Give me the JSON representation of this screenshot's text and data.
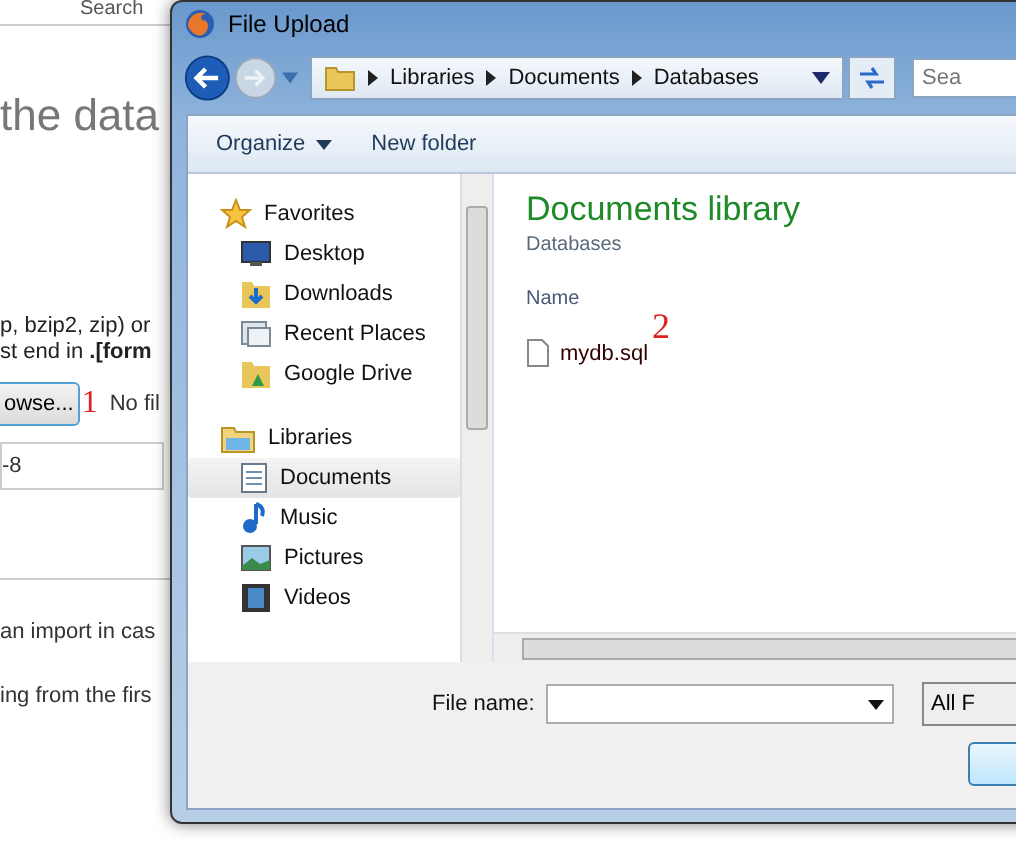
{
  "background_page": {
    "search_label": "Search",
    "heading": "the data",
    "paragraph_lines": [
      "p, bzip2, zip) or",
      "st end in **.[form**"
    ],
    "browse_button": "owse...",
    "browse_annotation": "1",
    "no_file_text": "No fil",
    "charset_select": "-8",
    "option_lines": [
      "an import in cas",
      "ing from the firs"
    ]
  },
  "dialog": {
    "title": "File Upload",
    "breadcrumb": [
      "Libraries",
      "Documents",
      "Databases"
    ],
    "search": {
      "placeholder": "Sea"
    },
    "toolbar": [
      {
        "label": "Organize",
        "dropdown": true
      },
      {
        "label": "New folder",
        "dropdown": false
      }
    ],
    "nav_tree": [
      {
        "label": "Favorites",
        "selected": false,
        "children": [
          {
            "label": "Desktop",
            "selected": false
          },
          {
            "label": "Downloads",
            "selected": false
          },
          {
            "label": "Recent Places",
            "selected": false
          },
          {
            "label": "Google Drive",
            "selected": false
          }
        ]
      },
      {
        "label": "Libraries",
        "selected": false,
        "children": [
          {
            "label": "Documents",
            "selected": true
          },
          {
            "label": "Music",
            "selected": false
          },
          {
            "label": "Pictures",
            "selected": false
          },
          {
            "label": "Videos",
            "selected": false
          }
        ]
      }
    ],
    "library_title": "Documents library",
    "library_subtitle": "Databases",
    "column_header": "Name",
    "files": [
      {
        "name": "mydb.sql",
        "annotation": "2",
        "selected": false
      }
    ],
    "file_name": {
      "label": "File name:"
    },
    "file_type": "All F"
  }
}
